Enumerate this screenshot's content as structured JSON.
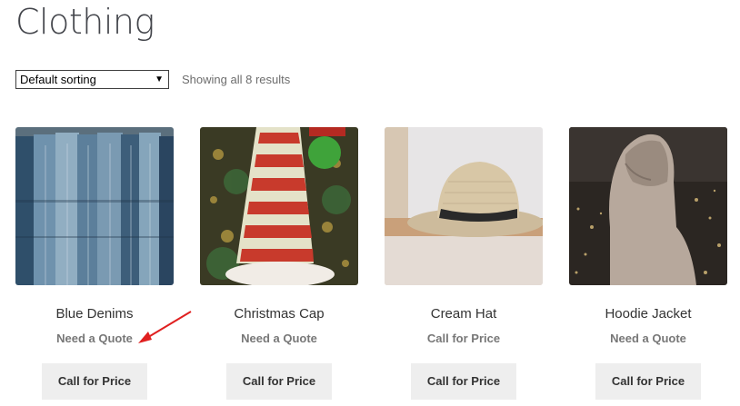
{
  "page": {
    "title": "Clothing"
  },
  "toolbar": {
    "sort_selected": "Default sorting",
    "result_count": "Showing all 8 results"
  },
  "products": [
    {
      "title": "Blue Denims",
      "price_note": "Need a Quote",
      "button": "Call for Price",
      "image": "blue-denims-photo"
    },
    {
      "title": "Christmas Cap",
      "price_note": "Need a Quote",
      "button": "Call for Price",
      "image": "christmas-cap-photo"
    },
    {
      "title": "Cream Hat",
      "price_note": "Call for Price",
      "button": "Call for Price",
      "image": "cream-hat-photo"
    },
    {
      "title": "Hoodie Jacket",
      "price_note": "Need a Quote",
      "button": "Call for Price",
      "image": "hoodie-jacket-photo"
    }
  ],
  "colors": {
    "annotation_arrow": "#e02020",
    "button_bg": "#eeeeee"
  }
}
